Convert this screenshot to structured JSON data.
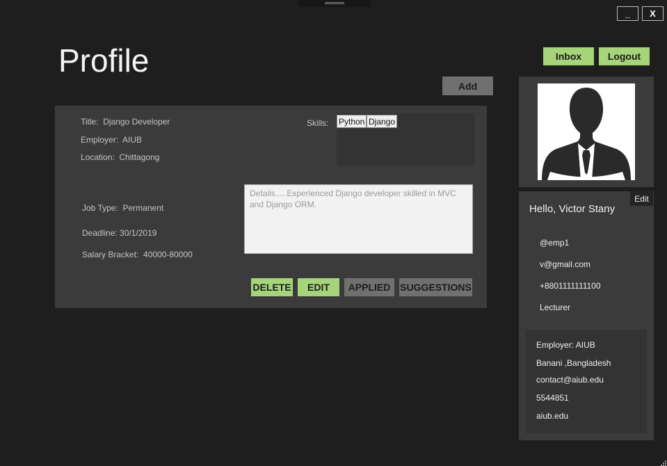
{
  "window": {
    "minimize_label": "_",
    "close_label": "X"
  },
  "header": {
    "title": "Profile",
    "inbox_label": "Inbox",
    "logout_label": "Logout",
    "add_label": "Add"
  },
  "job": {
    "title_label": "Title:",
    "title_value": "Django Developer",
    "employer_label": "Employer:",
    "employer_value": "AIUB",
    "location_label": "Location:",
    "location_value": "Chittagong",
    "skills_label": "Skills:",
    "skills": [
      "Python",
      "Django"
    ],
    "job_type_label": "Job Type:",
    "job_type_value": "Permanent",
    "deadline_label": "Deadline:",
    "deadline_value": "30/1/2019",
    "salary_label": "Salary Bracket:",
    "salary_value": "40000-80000",
    "details": "Details.....Experienced Django developer skilled in MVC and Django ORM.",
    "actions": {
      "delete": "DELETE",
      "edit": "EDIT",
      "applied": "APPLIED",
      "suggestions": "SUGGESTIONS"
    }
  },
  "profile": {
    "edit_label": "Edit",
    "greeting": "Hello, Victor Stany",
    "username": "@emp1",
    "email": "v@gmail.com",
    "phone": "+8801111111100",
    "designation": "Lecturer",
    "employer": {
      "name": "Employer: AIUB",
      "address": "Banani ,Bangladesh",
      "email": "contact@aiub.edu",
      "phone": "5544851",
      "website": "aiub.edu"
    }
  },
  "colors": {
    "background": "#1e1e1e",
    "panel": "#3b3b3b",
    "accent_green": "#a6d47a",
    "button_gray": "#707070"
  }
}
